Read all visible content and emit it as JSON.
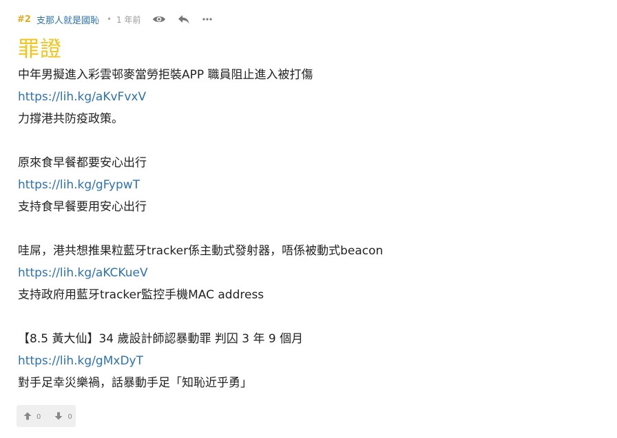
{
  "post": {
    "floor": "#2",
    "username": "支那人就是國恥",
    "separator": "•",
    "time": "1 年前",
    "icons": {
      "view": "eye-icon",
      "reply": "reply-icon",
      "more": "more-icon"
    },
    "title": "罪證",
    "lines": [
      {
        "text": "中年男擬進入彩雲邨麥當勞拒裝APP 職員阻止進入被打傷"
      },
      {
        "text": "https://lih.kg/aKvFvxV"
      },
      {
        "text": "力撐港共防疫政策。"
      },
      {
        "text": ""
      },
      {
        "text": "原來食早餐都要安心出行"
      },
      {
        "text": "https://lih.kg/gFypwT"
      },
      {
        "text": "支持食早餐要用安心出行"
      },
      {
        "text": ""
      },
      {
        "text": "哇屌，港共想推果粒藍牙tracker係主動式發射器，唔係被動式beacon"
      },
      {
        "text": "https://lih.kg/aKCKueV"
      },
      {
        "text": "支持政府用藍牙tracker監控手機MAC address"
      },
      {
        "text": ""
      },
      {
        "text": "【8.5 黃大仙】34 歲設計師認暴動罪 判囚 3 年 9 個月"
      },
      {
        "text": "https://lih.kg/gMxDyT"
      },
      {
        "text": "對手足幸災樂禍，話暴動手足「知恥近乎勇」"
      }
    ],
    "votes": {
      "up_count": "0",
      "down_count": "0"
    },
    "colors": {
      "floor": "#e5a81f",
      "username": "#2a72b5",
      "title": "#f0c419",
      "link": "#2a72b5"
    }
  }
}
